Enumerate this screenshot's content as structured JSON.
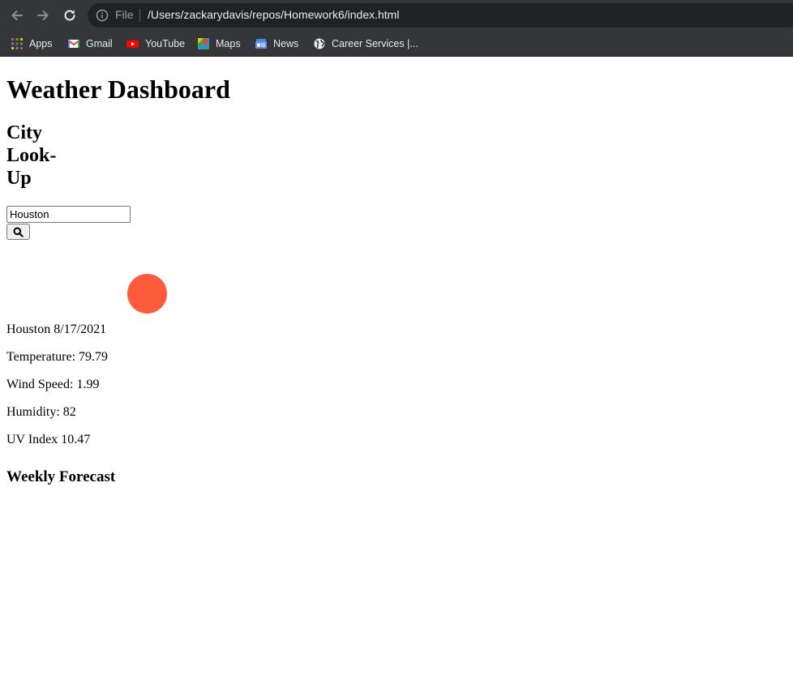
{
  "browser": {
    "omnibox": {
      "scheme_label": "File",
      "url": "/Users/zackarydavis/repos/Homework6/index.html"
    },
    "bookmarks": [
      {
        "label": "Apps",
        "icon": "apps-grid-icon"
      },
      {
        "label": "Gmail",
        "icon": "gmail-icon"
      },
      {
        "label": "YouTube",
        "icon": "youtube-icon"
      },
      {
        "label": "Maps",
        "icon": "maps-icon"
      },
      {
        "label": "News",
        "icon": "news-icon"
      },
      {
        "label": "Career Services |...",
        "icon": "globe-icon"
      }
    ]
  },
  "page": {
    "title": "Weather Dashboard",
    "lookup_heading": "City Look-Up",
    "search": {
      "value": "Houston",
      "button_icon": "search-icon"
    },
    "current": {
      "icon": "sun-icon",
      "icon_color": "#fc5c3c",
      "city_date": "Houston 8/17/2021",
      "temperature": "Temperature: 79.79",
      "wind": "Wind Speed: 1.99",
      "humidity": "Humidity: 82",
      "uv": "UV Index 10.47"
    },
    "forecast_heading": "Weekly Forecast"
  }
}
